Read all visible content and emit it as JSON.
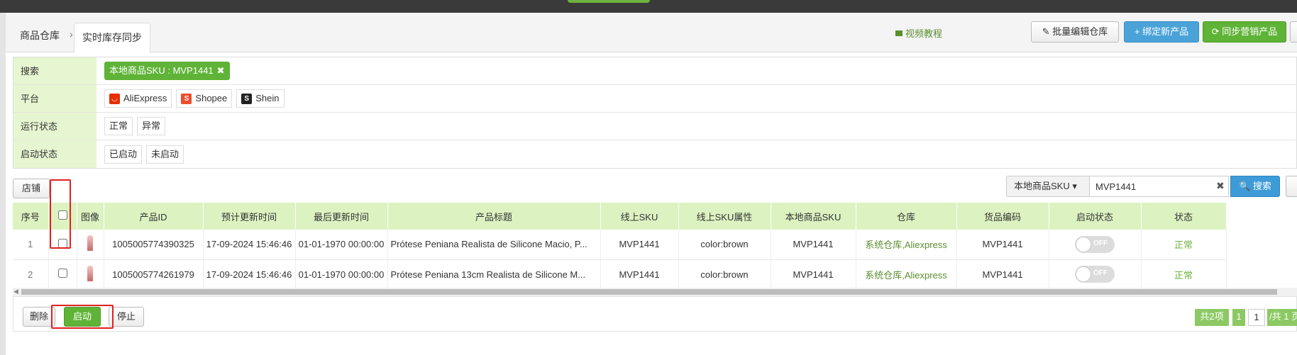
{
  "breadcrumb": {
    "home": "商品仓库",
    "sep": "›",
    "active_tab": "实时库存同步"
  },
  "header": {
    "video_link": "视频教程",
    "batch_edit": "批量编辑仓库",
    "bind_new": "+ 绑定新产品",
    "sync_marketing": "同步营销产品"
  },
  "filters": {
    "search_label": "搜索",
    "search_chip": "本地商品SKU : MVP1441",
    "platform_label": "平台",
    "platforms": [
      "AliExpress",
      "Shopee",
      "Shein"
    ],
    "run_label": "运行状态",
    "run_opts": [
      "正常",
      "异常"
    ],
    "start_label": "启动状态",
    "start_opts": [
      "已启动",
      "未启动"
    ]
  },
  "toolbar": {
    "store_button": "店铺",
    "search_type": "本地商品SKU ▾",
    "search_value": "MVP1441",
    "search_button": "搜索"
  },
  "table": {
    "headers": [
      "序号",
      "图像",
      "产品ID",
      "预计更新时间",
      "最后更新时间",
      "产品标题",
      "线上SKU",
      "线上SKU属性",
      "本地商品SKU",
      "仓库",
      "货品编码",
      "启动状态",
      "状态"
    ],
    "rows": [
      {
        "idx": "1",
        "product_id": "1005005774390325",
        "next_update": "17-09-2024 15:46:46",
        "last_update": "01-01-1970 00:00:00",
        "title": "Prótese Peniana Realista de Silicone Macio, P...",
        "online_sku": "MVP1441",
        "sku_attr": "color:brown",
        "local_sku": "MVP1441",
        "warehouse": "系统仓库,Aliexpress",
        "goods_code": "MVP1441",
        "toggle": "OFF",
        "status": "正常"
      },
      {
        "idx": "2",
        "product_id": "1005005774261979",
        "next_update": "17-09-2024 15:46:46",
        "last_update": "01-01-1970 00:00:00",
        "title": "Prótese Peniana 13cm Realista de Silicone M...",
        "online_sku": "MVP1441",
        "sku_attr": "color:brown",
        "local_sku": "MVP1441",
        "warehouse": "系统仓库,Aliexpress",
        "goods_code": "MVP1441",
        "toggle": "OFF",
        "status": "正常"
      }
    ]
  },
  "footer": {
    "delete": "删除",
    "start": "启动",
    "stop": "停止",
    "total": "共2项",
    "page": "1",
    "page_input": "1",
    "of": "/共 1 页"
  }
}
